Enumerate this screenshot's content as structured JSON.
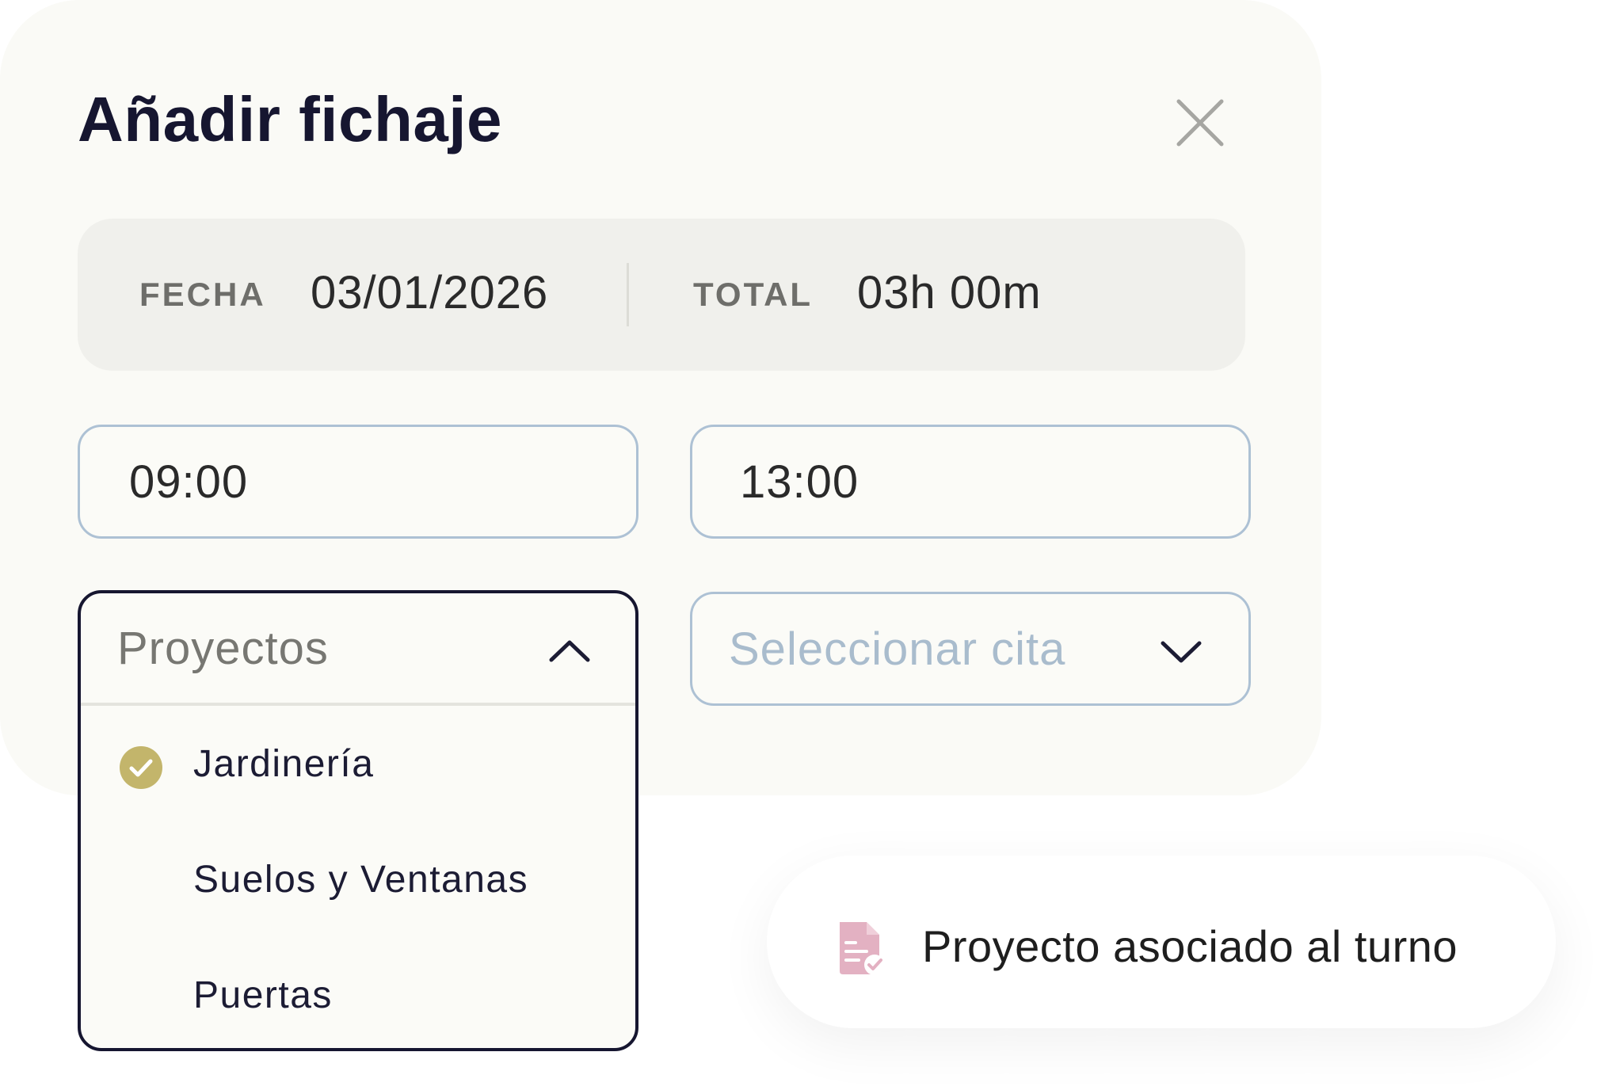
{
  "dialog": {
    "title": "Añadir fichaje",
    "close_icon": "close-icon"
  },
  "summary": {
    "date_label": "FECHA",
    "date_value": "03/01/2026",
    "total_label": "TOTAL",
    "total_value": "03h 00m"
  },
  "times": {
    "start": "09:00",
    "end": "13:00"
  },
  "projects_dropdown": {
    "label": "Proyectos",
    "state": "open",
    "icon": "chevron-up-icon",
    "items": [
      {
        "label": "Jardinería",
        "selected": true
      },
      {
        "label": "Suelos y Ventanas",
        "selected": false
      },
      {
        "label": "Puertas",
        "selected": false
      }
    ]
  },
  "appointment_select": {
    "placeholder": "Seleccionar cita",
    "icon": "chevron-down-icon"
  },
  "tooltip": {
    "icon": "document-check-icon",
    "text": "Proyecto asociado al turno"
  },
  "colors": {
    "background": "#fafaf6",
    "title": "#161630",
    "field_border": "#adc1d4",
    "dropdown_border": "#161630",
    "check": "#c3b56b",
    "placeholder": "#a9bccd",
    "doc_icon": "#e3b1c2"
  }
}
